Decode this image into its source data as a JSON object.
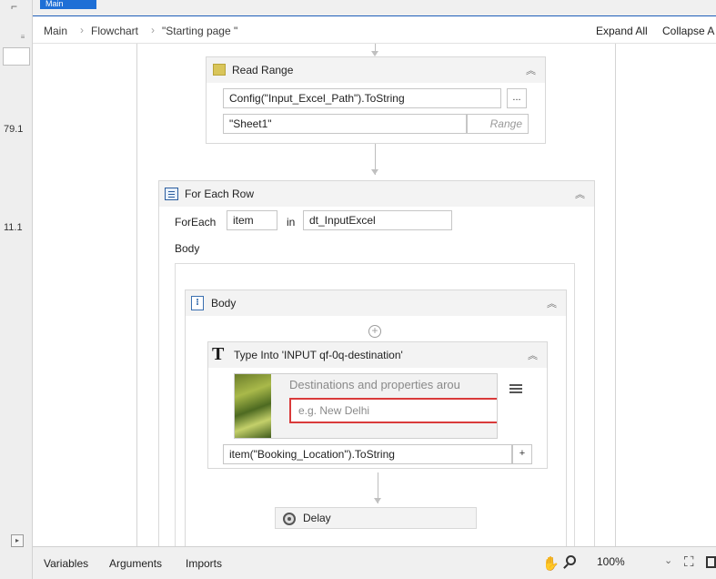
{
  "tab": {
    "label": "Main"
  },
  "gutter": {
    "value_1": "79.1",
    "value_2": "11.1"
  },
  "breadcrumb": {
    "items": [
      "Main",
      "Flowchart",
      "\"Starting page \""
    ],
    "expand_all": "Expand All",
    "collapse_all": "Collapse A"
  },
  "read_range": {
    "title": "Read Range",
    "path_value": "Config(\"Input_Excel_Path\").ToString",
    "browse_label": "...",
    "sheet_value": "\"Sheet1\"",
    "range_placeholder": "Range"
  },
  "for_each_row": {
    "title": "For Each Row",
    "foreach_label": "ForEach",
    "item_value": "item",
    "in_label": "in",
    "collection_value": "dt_InputExcel",
    "body_label": "Body"
  },
  "body_sequence": {
    "title": "Body"
  },
  "type_into": {
    "title": "Type Into 'INPUT  qf-0q-destination'",
    "preview_text": "Destinations and properties arou",
    "preview_placeholder": "e.g. New Delhi",
    "text_value": "item(\"Booking_Location\").ToString",
    "plus_label": "+"
  },
  "delay": {
    "title": "Delay"
  },
  "bottom_bar": {
    "variables": "Variables",
    "arguments": "Arguments",
    "imports": "Imports",
    "zoom": "100%"
  }
}
